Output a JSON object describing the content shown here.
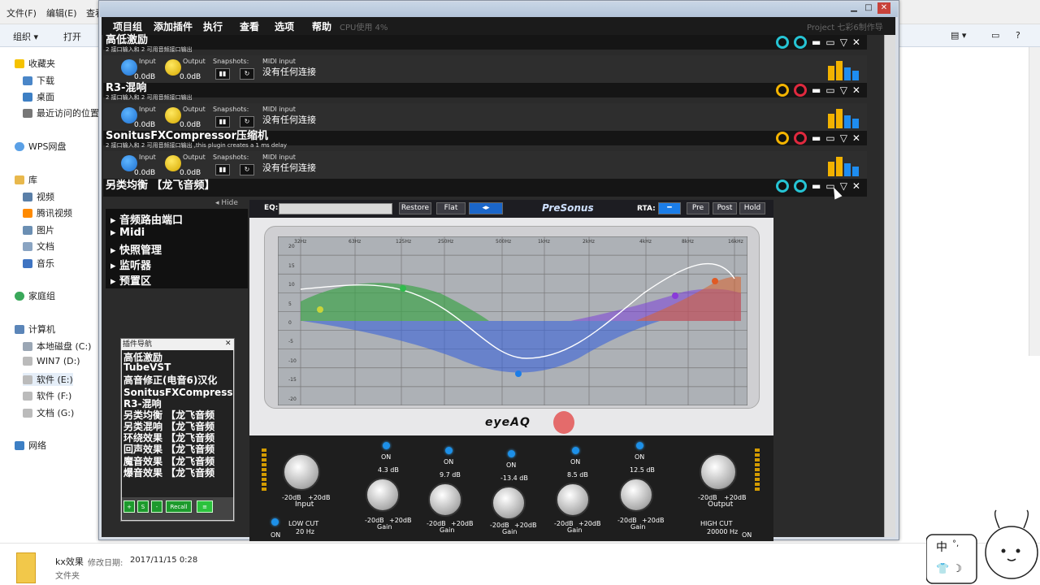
{
  "explorer": {
    "menu": [
      "文件(F)",
      "编辑(E)",
      "查看"
    ],
    "toolbar": {
      "organize": "组织 ▾",
      "open": "打开"
    },
    "nav": {
      "favorites": "收藏夹",
      "downloads": "下载",
      "desktop": "桌面",
      "recent": "最近访问的位置",
      "wps": "WPS网盘",
      "library": "库",
      "video": "视频",
      "tencent_video": "腾讯视频",
      "pictures": "图片",
      "docs": "文档",
      "music": "音乐",
      "homegroup": "家庭组",
      "computer": "计算机",
      "disk_c": "本地磁盘 (C:)",
      "disk_d": "WIN7 (D:)",
      "disk_e": "软件 (E:)",
      "disk_f": "软件 (F:)",
      "disk_g": "文档 (G:)",
      "network": "网络"
    },
    "status": {
      "name": "kx效果",
      "modified_label": "修改日期:",
      "modified": "2017/11/15 0:28",
      "type": "文件夹"
    }
  },
  "host": {
    "menu": [
      "项目组",
      "添加插件",
      "执行",
      "查看",
      "选项",
      "帮助"
    ],
    "cpu": "CPU使用  4%",
    "project": "Project 七彩6制作导"
  },
  "plugins": [
    {
      "name": "高低激励",
      "sub": "2 接口输入和 2 可用音频接口输出"
    },
    {
      "name": "R3-混响",
      "sub": "2 接口输入和 2 可用音频接口输出"
    },
    {
      "name": "SonitusFXCompressor压缩机",
      "sub": "2 接口输入和 2 可用音频接口输出  ,this plugin creates a 1 ms delay"
    },
    {
      "name": "另类均衡 【龙飞音频】",
      "sub": ""
    }
  ],
  "controls": {
    "input": "Input",
    "output": "Output",
    "snapshots": "Snapshots:",
    "midi_label": "MIDI input",
    "midi_value": "没有任何连接",
    "in_val": "0.0dB",
    "out_val": "0.0dB"
  },
  "side": {
    "hide": "◂ Hide",
    "items": [
      "▸ 音频路由端口",
      "▸ Midi",
      "▸ 快照管理",
      "▸ 监听器",
      "▸ 预置区"
    ]
  },
  "plugin_nav": {
    "title": "插件导航",
    "items": [
      "高低激励",
      "TubeVST",
      "高音修正(电音6)汉化",
      "SonitusFXCompressor压",
      "R3-混响",
      "另类均衡 【龙飞音频",
      "另类混响 【龙飞音频",
      "环绕效果 【龙飞音频",
      "回声效果 【龙飞音频",
      "魔音效果 【龙飞音频",
      "爆音效果 【龙飞音频"
    ],
    "recall": "Recall"
  },
  "eq": {
    "eq_label": "EQ:",
    "restore": "Restore",
    "flat": "Flat",
    "brand": "PreSonus",
    "rta": "RTA:",
    "pre": "Pre",
    "post": "Post",
    "hold": "Hold",
    "logo": "eyeAQ",
    "on": "ON",
    "freq_ticks": [
      "32Hz",
      "63Hz",
      "125Hz",
      "250Hz",
      "500Hz",
      "1kHz",
      "2kHz",
      "4kHz",
      "8kHz",
      "16kHz"
    ],
    "db_ticks": [
      "20",
      "15",
      "10",
      "5",
      "0",
      "-5",
      "-10",
      "-15",
      "-20"
    ],
    "input_label": "Input",
    "output_label": "Output",
    "knob_min": "-20dB",
    "knob_max": "+20dB",
    "gain": "Gain",
    "bands": [
      "4.3 dB",
      "9.7 dB",
      "-13.4 dB",
      "8.5 dB",
      "12.5 dB"
    ],
    "lowcut": "LOW CUT",
    "lowcut_val": "20 Hz",
    "highcut": "HIGH CUT",
    "highcut_val": "20000 Hz",
    "on_small": "ON"
  }
}
